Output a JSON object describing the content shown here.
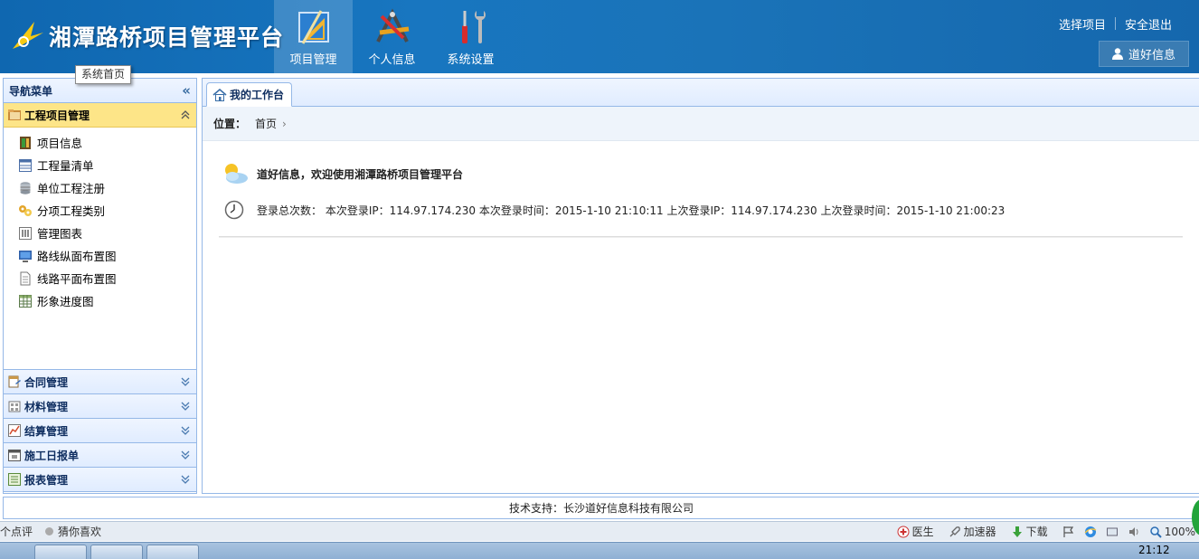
{
  "header": {
    "logo_text": "湘潭路桥项目管理平台",
    "tooltip": "系统首页",
    "nav": [
      {
        "label": "项目管理",
        "icon": "ruler-triangle-icon"
      },
      {
        "label": "个人信息",
        "icon": "compass-pencil-icon"
      },
      {
        "label": "系统设置",
        "icon": "tools-icon"
      }
    ],
    "select_project": "选择项目",
    "logout": "安全退出",
    "user": "道好信息"
  },
  "sidebar": {
    "title": "导航菜单",
    "open_section": "工程项目管理",
    "items": [
      {
        "label": "项目信息",
        "icon": "book-icon"
      },
      {
        "label": "工程量清单",
        "icon": "table-icon"
      },
      {
        "label": "单位工程注册",
        "icon": "database-icon"
      },
      {
        "label": "分项工程类别",
        "icon": "gears-icon"
      },
      {
        "label": "管理图表",
        "icon": "bar-chart-icon"
      },
      {
        "label": "路线纵面布置图",
        "icon": "monitor-icon"
      },
      {
        "label": "线路平面布置图",
        "icon": "document-icon"
      },
      {
        "label": "形象进度图",
        "icon": "grid-icon"
      }
    ],
    "sections": [
      {
        "label": "合同管理",
        "icon": "contract-icon"
      },
      {
        "label": "材料管理",
        "icon": "materials-icon"
      },
      {
        "label": "结算管理",
        "icon": "line-chart-icon"
      },
      {
        "label": "施工日报单",
        "icon": "calendar-icon"
      },
      {
        "label": "报表管理",
        "icon": "report-icon"
      }
    ]
  },
  "main": {
    "tab": "我的工作台",
    "location_label": "位置：",
    "location_home": "首页",
    "welcome": "道好信息，欢迎使用湘潭路桥项目管理平台",
    "login_info": "登录总次数： 本次登录IP：114.97.174.230 本次登录时间：2015-1-10 21:10:11 上次登录IP：114.97.174.230 上次登录时间：2015-1-10 21:00:23"
  },
  "footer": {
    "support": "技术支持：长沙道好信息科技有限公司"
  },
  "statusbar": {
    "left1": "个点评",
    "left2": "猜你喜欢",
    "doctor": "医生",
    "accelerator": "加速器",
    "download": "下载",
    "zoom": "100%"
  },
  "taskbar": {
    "clock": "21:12"
  },
  "colors": {
    "header_blue": "#1876c0",
    "panel_border": "#95b8e7",
    "open_section": "#fde588"
  }
}
